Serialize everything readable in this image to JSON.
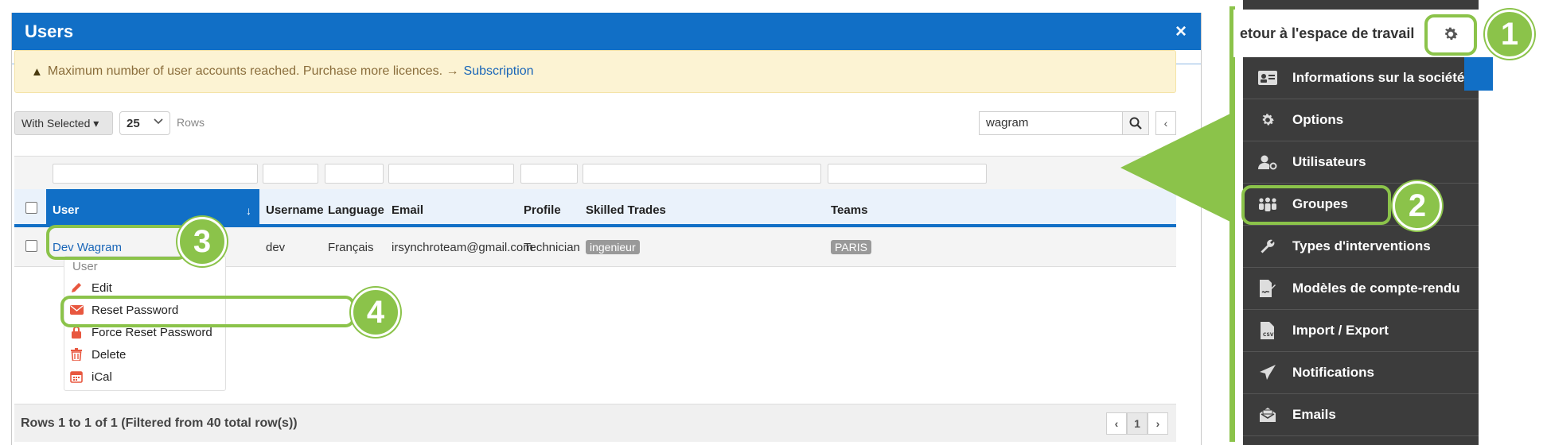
{
  "modal": {
    "title": "Users",
    "close_glyph": "×"
  },
  "alert": {
    "icon": "warning-icon",
    "text": "Maximum number of user accounts reached. Purchase more licences. →",
    "link": "Subscription"
  },
  "toolbar": {
    "with_selected": "With Selected ▾",
    "rows_value": "25",
    "rows_label": "Rows",
    "search_value": "wagram"
  },
  "table": {
    "columns": [
      "User",
      "Username",
      "Language",
      "Email",
      "Profile",
      "Skilled Trades",
      "Teams"
    ],
    "rows": [
      {
        "user": "Dev Wagram",
        "username": "dev",
        "language": "Français",
        "email": "irsynchroteam@gmail.com",
        "profile": "Technician",
        "skilled_trades": "ingenieur",
        "teams": "PARIS"
      }
    ],
    "footer": "Rows 1 to 1 of 1 (Filtered from 40 total row(s))",
    "page": "1"
  },
  "context_menu": {
    "header": "User",
    "items": [
      {
        "label": "Edit",
        "icon": "pencil-icon"
      },
      {
        "label": "Reset Password",
        "icon": "envelope-icon"
      },
      {
        "label": "Force Reset Password",
        "icon": "lock-icon"
      },
      {
        "label": "Delete",
        "icon": "trash-icon"
      },
      {
        "label": "iCal",
        "icon": "calendar-icon"
      }
    ]
  },
  "settings_menu": {
    "back_label": "etour à l'espace de travail",
    "items": [
      {
        "label": "Informations sur la société",
        "icon": "id-card-icon"
      },
      {
        "label": "Options",
        "icon": "gear-icon"
      },
      {
        "label": "Utilisateurs",
        "icon": "user-cog-icon"
      },
      {
        "label": "Groupes",
        "icon": "users-group-icon"
      },
      {
        "label": "Types d'interventions",
        "icon": "wrench-icon"
      },
      {
        "label": "Modèles de compte-rendu",
        "icon": "file-signature-icon"
      },
      {
        "label": "Import / Export",
        "icon": "file-csv-icon"
      },
      {
        "label": "Notifications",
        "icon": "paper-plane-icon"
      },
      {
        "label": "Emails",
        "icon": "envelope-open-icon"
      }
    ]
  },
  "callouts": [
    "1",
    "2",
    "3",
    "4"
  ],
  "colors": {
    "primary": "#116fc6",
    "callout": "#8bc34a",
    "menu_bg": "#3c3c3c",
    "alert_bg": "#fcf3d3",
    "danger": "#e8573f"
  }
}
